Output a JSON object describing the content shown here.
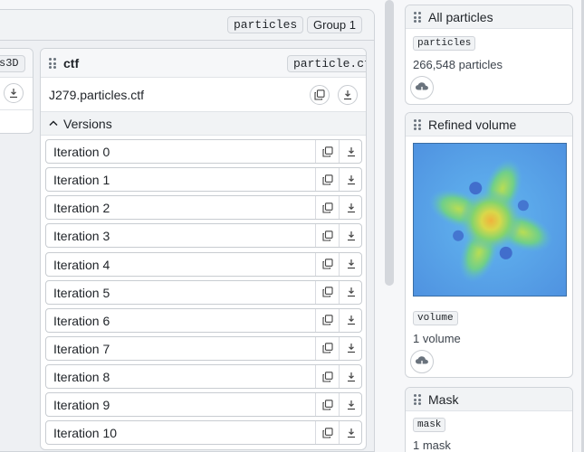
{
  "left_panel": {
    "tags": [
      "particles",
      "Group 1"
    ]
  },
  "partial_card": {
    "tag_fragment": "s3D"
  },
  "ctf_card": {
    "title": "ctf",
    "tag": "particle.ctf",
    "file_name": "J279.particles.ctf",
    "versions_label": "Versions",
    "iterations": [
      "Iteration 0",
      "Iteration 1",
      "Iteration 2",
      "Iteration 3",
      "Iteration 4",
      "Iteration 5",
      "Iteration 6",
      "Iteration 7",
      "Iteration 8",
      "Iteration 9",
      "Iteration 10"
    ]
  },
  "right_cards": {
    "all_particles": {
      "title": "All particles",
      "tag": "particles",
      "count": "266,548 particles"
    },
    "refined_volume": {
      "title": "Refined volume",
      "tag": "volume",
      "count": "1 volume"
    },
    "mask": {
      "title": "Mask",
      "tag": "mask",
      "count": "1 mask"
    }
  },
  "icons": {
    "grip": "drag-handle-icon",
    "copy": "copy-icon",
    "download": "download-icon",
    "chevron": "chevron-up-icon",
    "cloud": "cloud-download-icon"
  },
  "colors": {
    "panel_bg": "#eef0f3",
    "border": "#d0d4d9",
    "volume_bg": "#5ba8ea"
  }
}
